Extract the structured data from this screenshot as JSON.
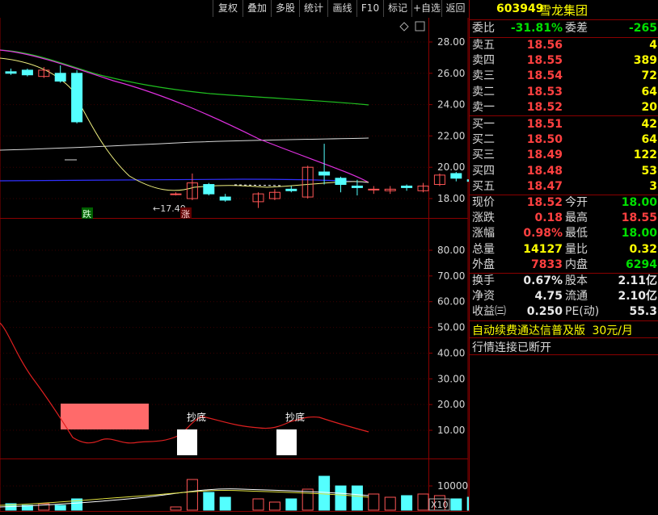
{
  "toolbar": {
    "buttons": [
      "复权",
      "叠加",
      "多股",
      "统计",
      "画线",
      "F10",
      "标记",
      "+自选",
      "返回"
    ]
  },
  "kline": {
    "price_ticks": [
      "28.00",
      "26.00",
      "24.00",
      "22.00",
      "20.00",
      "18.00"
    ],
    "min_marker": "←17.40",
    "down_tag": "跌",
    "up_tag": "涨",
    "candles": [
      {
        "o": 26.1,
        "c": 26.0,
        "h": 26.3,
        "l": 25.9
      },
      {
        "o": 26.2,
        "c": 25.9,
        "h": 26.3,
        "l": 25.8
      },
      {
        "o": 25.8,
        "c": 26.2,
        "h": 26.4,
        "l": 25.7
      },
      {
        "o": 26.0,
        "c": 25.5,
        "h": 26.5,
        "l": 25.4
      },
      {
        "o": 26.0,
        "c": 22.9,
        "h": 26.2,
        "l": 22.8
      },
      {
        "o": null,
        "c": null,
        "h": null,
        "l": null
      },
      {
        "o": null,
        "c": null,
        "h": null,
        "l": null
      },
      {
        "o": null,
        "c": null,
        "h": null,
        "l": null
      },
      {
        "o": null,
        "c": null,
        "h": null,
        "l": null
      },
      {
        "o": null,
        "c": null,
        "h": null,
        "l": null
      },
      {
        "o": 18.3,
        "c": 18.3,
        "h": 18.4,
        "l": 18.2
      },
      {
        "o": 18.0,
        "c": 19.0,
        "h": 19.6,
        "l": 17.9
      },
      {
        "o": 18.9,
        "c": 18.3,
        "h": 19.0,
        "l": 18.2
      },
      {
        "o": 18.1,
        "c": 17.9,
        "h": 18.3,
        "l": 17.8
      },
      {
        "o": null,
        "c": null,
        "h": null,
        "l": null
      },
      {
        "o": 17.8,
        "c": 18.3,
        "h": 18.4,
        "l": 17.4
      },
      {
        "o": 18.0,
        "c": 18.4,
        "h": 18.6,
        "l": 17.9
      },
      {
        "o": 18.6,
        "c": 18.5,
        "h": 18.8,
        "l": 18.4
      },
      {
        "o": 18.1,
        "c": 20.0,
        "h": 20.1,
        "l": 18.0
      },
      {
        "o": 19.7,
        "c": 19.5,
        "h": 21.5,
        "l": 18.9
      },
      {
        "o": 19.3,
        "c": 18.9,
        "h": 19.4,
        "l": 18.4
      },
      {
        "o": 18.8,
        "c": 18.7,
        "h": 19.2,
        "l": 18.2
      },
      {
        "o": 18.6,
        "c": 18.6,
        "h": 18.8,
        "l": 18.3
      },
      {
        "o": 18.5,
        "c": 18.6,
        "h": 18.8,
        "l": 18.3
      },
      {
        "o": 18.8,
        "c": 18.7,
        "h": 18.9,
        "l": 18.5
      },
      {
        "o": 18.5,
        "c": 18.8,
        "h": 19.0,
        "l": 18.4
      },
      {
        "o": 18.9,
        "c": 19.5,
        "h": 19.6,
        "l": 18.8
      },
      {
        "o": 19.6,
        "c": 19.3,
        "h": 19.7,
        "l": 19.1
      },
      {
        "o": 19.2,
        "c": 19.1,
        "h": 19.3,
        "l": 18.9
      },
      {
        "o": 19.0,
        "c": 18.6,
        "h": 19.1,
        "l": 18.5
      },
      {
        "o": 18.6,
        "c": 18.8,
        "h": 18.9,
        "l": 18.5
      },
      {
        "o": 18.6,
        "c": 18.4,
        "h": 18.9,
        "l": 17.6
      }
    ]
  },
  "oscillator": {
    "ticks": [
      "80.00",
      "70.00",
      "60.00",
      "50.00",
      "40.00",
      "30.00",
      "20.00",
      "10.00"
    ],
    "labels": [
      "抄底",
      "抄底"
    ]
  },
  "volume": {
    "ticks": [
      "10000"
    ],
    "unit": "X10"
  },
  "quote": {
    "code": "603949",
    "name": "雪龙集团",
    "weibi_label": "委比",
    "weibi": "-31.81%",
    "weicha_label": "委差",
    "weicha": "-265",
    "asks": [
      {
        "label": "卖五",
        "price": "18.56",
        "vol": "4"
      },
      {
        "label": "卖四",
        "price": "18.55",
        "vol": "389"
      },
      {
        "label": "卖三",
        "price": "18.54",
        "vol": "72"
      },
      {
        "label": "卖二",
        "price": "18.53",
        "vol": "64"
      },
      {
        "label": "卖一",
        "price": "18.52",
        "vol": "20"
      }
    ],
    "bids": [
      {
        "label": "买一",
        "price": "18.51",
        "vol": "42"
      },
      {
        "label": "买二",
        "price": "18.50",
        "vol": "64"
      },
      {
        "label": "买三",
        "price": "18.49",
        "vol": "122"
      },
      {
        "label": "买四",
        "price": "18.48",
        "vol": "53"
      },
      {
        "label": "买五",
        "price": "18.47",
        "vol": "3"
      }
    ],
    "stats": [
      {
        "l1": "现价",
        "v1": "18.52",
        "l2": "今开",
        "v2": "18.00"
      },
      {
        "l1": "涨跌",
        "v1": "0.18",
        "l2": "最高",
        "v2": "18.55"
      },
      {
        "l1": "涨幅",
        "v1": "0.98%",
        "l2": "最低",
        "v2": "18.00"
      },
      {
        "l1": "总量",
        "v1": "14127",
        "l2": "量比",
        "v2": "0.32"
      },
      {
        "l1": "外盘",
        "v1": "7833",
        "l2": "内盘",
        "v2": "6294"
      }
    ],
    "finance": [
      {
        "l1": "换手",
        "v1": "0.67%",
        "l2": "股本",
        "v2": "2.11亿"
      },
      {
        "l1": "净资",
        "v1": "4.75",
        "l2": "流通",
        "v2": "2.10亿"
      },
      {
        "l1": "收益㈢",
        "v1": "0.250",
        "l2": "PE(动)",
        "v2": "55.3"
      }
    ],
    "ad_text": "自动续费通达信普及版",
    "ad_price": "30元/月",
    "status_text": "行情连接已断开"
  },
  "colors": {
    "up": "#ff5555",
    "down": "#54ffff",
    "border": "#8b0000"
  }
}
